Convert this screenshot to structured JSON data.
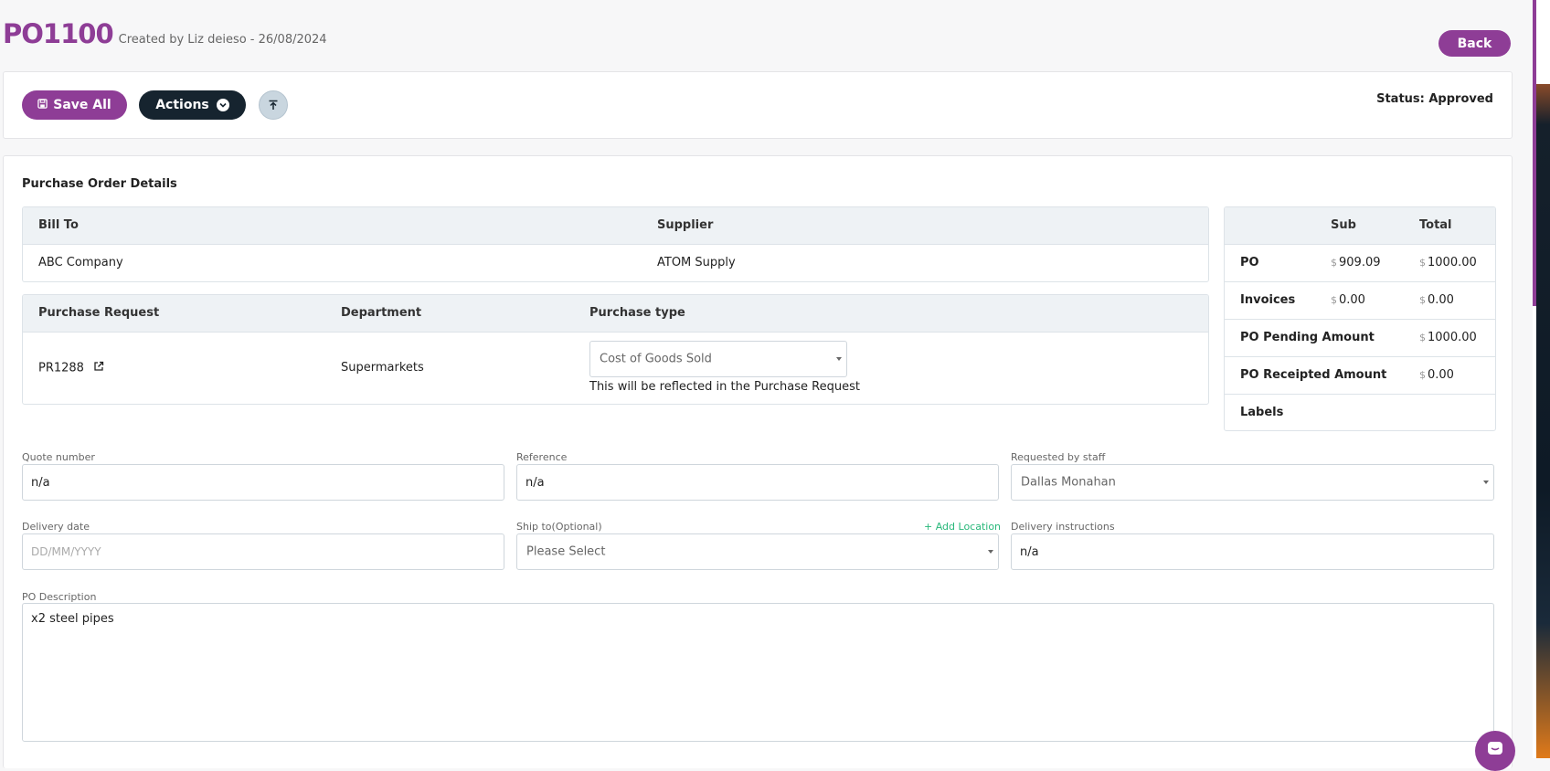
{
  "header": {
    "po_number": "PO1100",
    "created_text": "Created by Liz deieso - 26/08/2024",
    "back_label": "Back"
  },
  "toolbar": {
    "save_label": "Save All",
    "actions_label": "Actions",
    "status_text": "Status: Approved"
  },
  "details": {
    "section_title": "Purchase Order Details",
    "bill_to": {
      "header": "Bill To",
      "value": "ABC Company"
    },
    "supplier": {
      "header": "Supplier",
      "value": "ATOM Supply"
    },
    "purchase_request": {
      "header": "Purchase Request",
      "value": "PR1288"
    },
    "department": {
      "header": "Department",
      "value": "Supermarkets"
    },
    "purchase_type": {
      "header": "Purchase type",
      "value": "Cost of Goods Sold",
      "note": "This will be reflected in the Purchase Request"
    }
  },
  "summary": {
    "col_sub": "Sub",
    "col_total": "Total",
    "currency": "$",
    "rows": [
      {
        "label": "PO",
        "sub": "909.09",
        "total": "1000.00"
      },
      {
        "label": "Invoices",
        "sub": "0.00",
        "total": "0.00"
      },
      {
        "label": "PO Pending Amount",
        "sub": "",
        "total": "1000.00"
      },
      {
        "label": "PO Receipted Amount",
        "sub": "",
        "total": "0.00"
      },
      {
        "label": "Labels",
        "sub": "",
        "total": ""
      }
    ]
  },
  "form": {
    "quote_number": {
      "label": "Quote number",
      "value": "n/a"
    },
    "reference": {
      "label": "Reference",
      "value": "n/a"
    },
    "requested_by": {
      "label": "Requested by staff",
      "value": "Dallas Monahan"
    },
    "delivery_date": {
      "label": "Delivery date",
      "placeholder": "DD/MM/YYYY"
    },
    "ship_to": {
      "label": "Ship to(Optional)",
      "add_location": "+ Add Location",
      "value": "Please Select"
    },
    "delivery_instructions": {
      "label": "Delivery instructions",
      "value": "n/a"
    },
    "po_description": {
      "label": "PO Description",
      "value": "x2 steel pipes"
    }
  },
  "colors": {
    "brand": "#8e3d96",
    "dark_button": "#16242f",
    "success": "#28b87a"
  },
  "icons": [
    "save-icon",
    "chevron-down-icon",
    "scroll-to-top-icon",
    "external-link-icon",
    "chat-icon"
  ]
}
